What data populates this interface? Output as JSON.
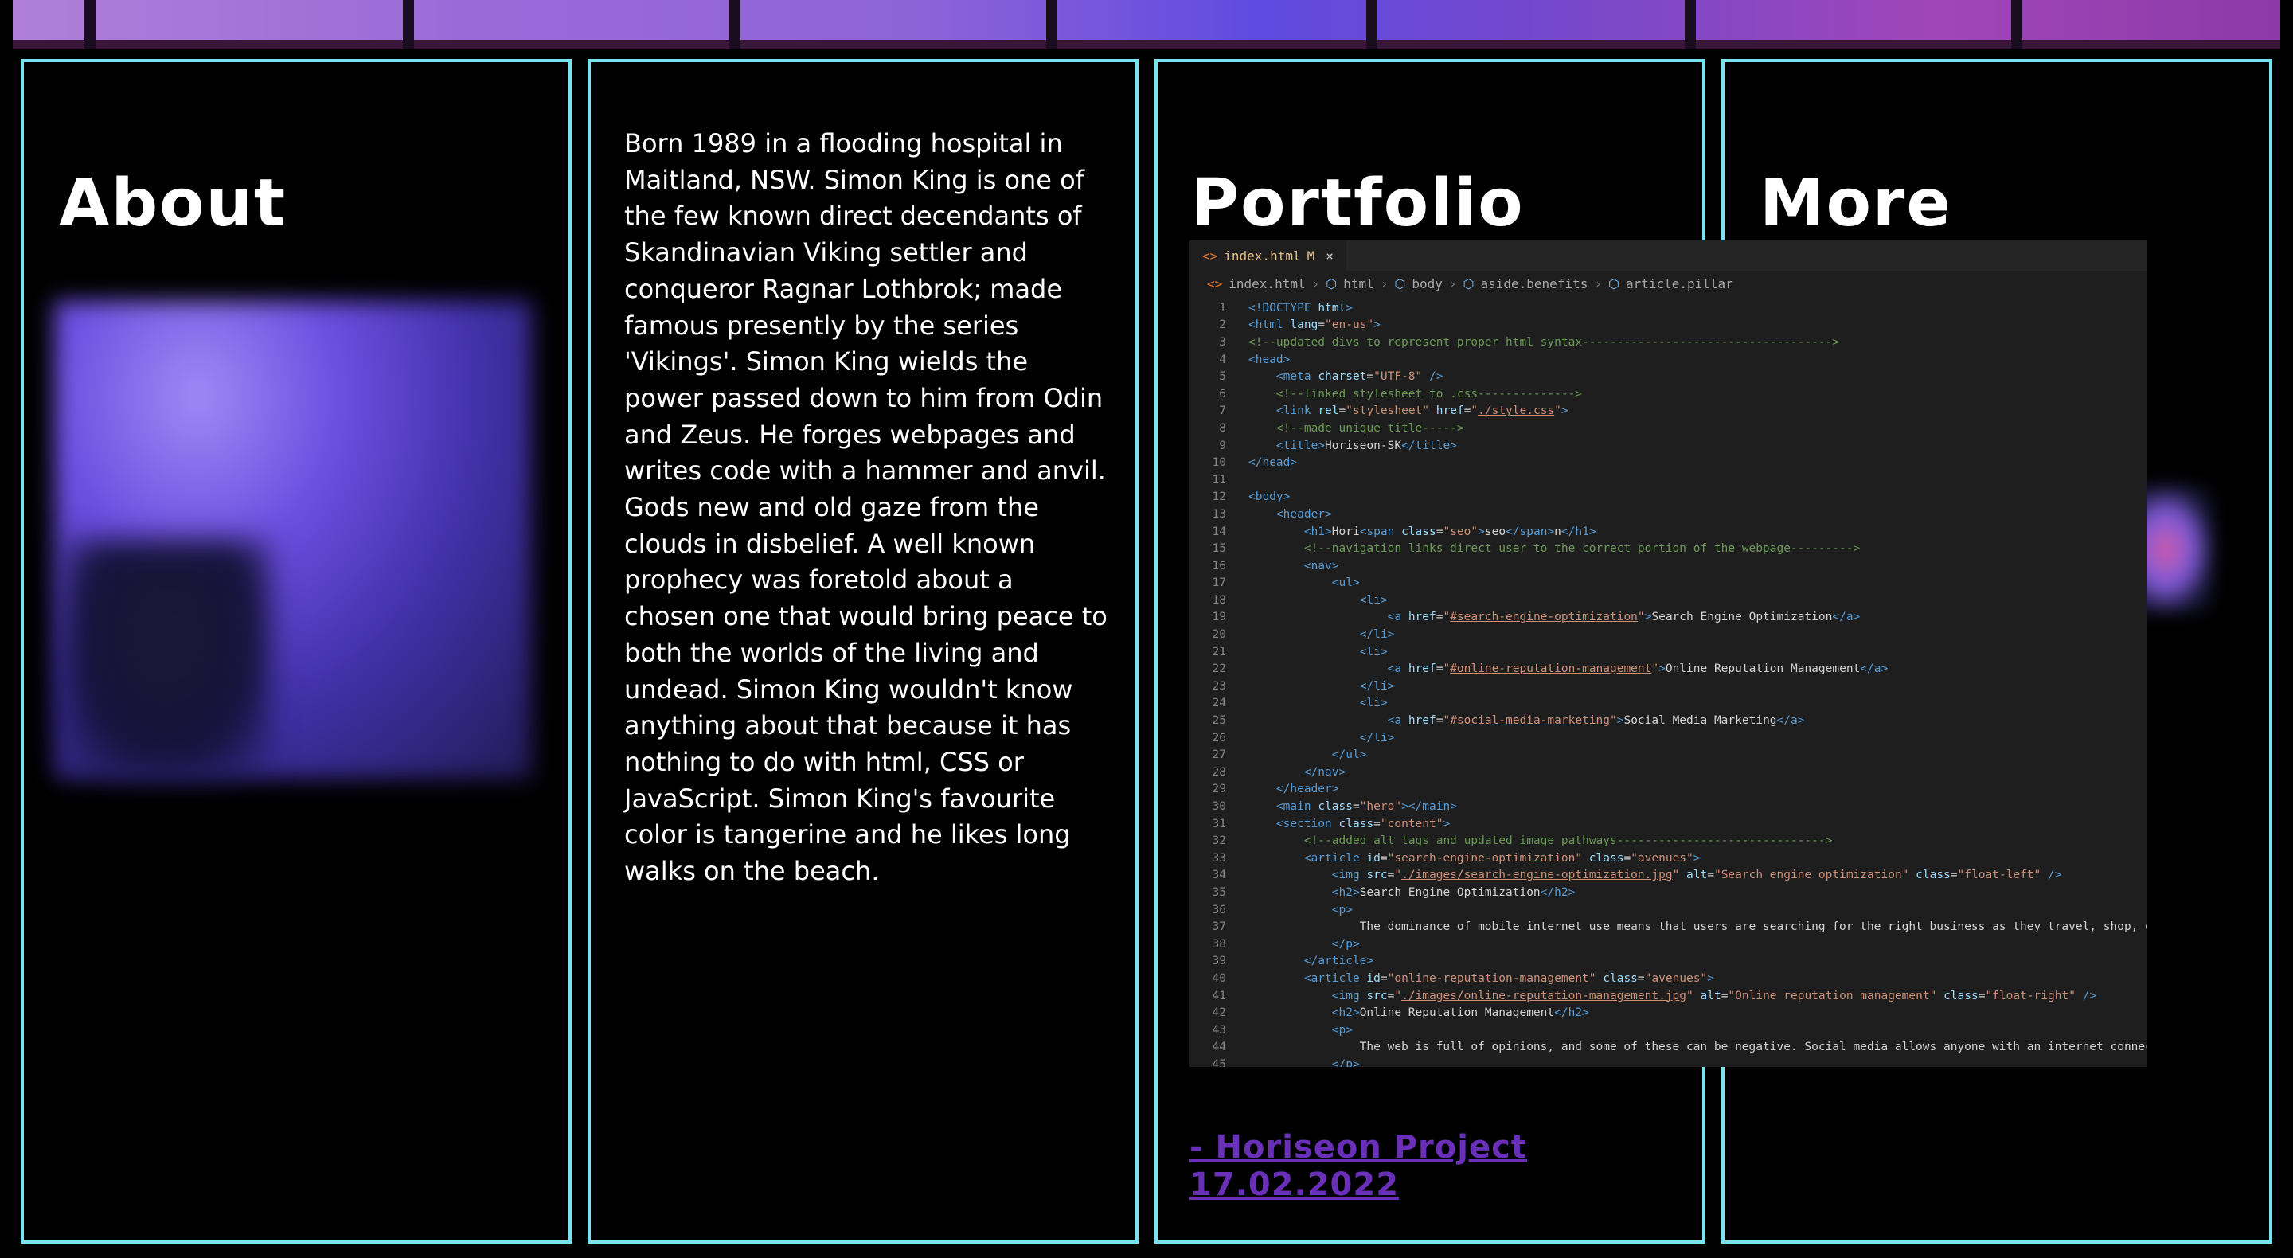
{
  "panels": {
    "about": {
      "title": "About",
      "image": "blurred-profile-photo"
    },
    "bio": {
      "text": "Born 1989 in a flooding hospital in Maitland, NSW. Simon King is one of the few known direct decendants of Skandinavian Viking settler and conqueror Ragnar Lothbrok; made famous presently by the series 'Vikings'. Simon King wields the power passed down to him from Odin and Zeus. He forges webpages and writes code with a hammer and anvil. Gods new and old gaze from the clouds in disbelief. A well known prophecy was foretold about a chosen one that would bring peace to both the worlds of the living and undead. Simon King wouldn't know anything about that because it has nothing to do with html, CSS or JavaScript. Simon King's favourite color is tangerine and he likes long walks on the beach."
    },
    "portfolio": {
      "title": "Portfolio",
      "editor": {
        "tab": "index.html",
        "tab_status": "M",
        "tab_close": "×",
        "breadcrumbs": [
          "index.html",
          "html",
          "body",
          "aside.benefits",
          "article.pillar"
        ]
      },
      "link_line1": "- Horiseon Project",
      "link_line2": "17.02.2022"
    },
    "more": {
      "title": "More"
    }
  },
  "colors": {
    "panel_border": "#7be3ee",
    "link": "#6a2fb8",
    "background": "#000000"
  }
}
